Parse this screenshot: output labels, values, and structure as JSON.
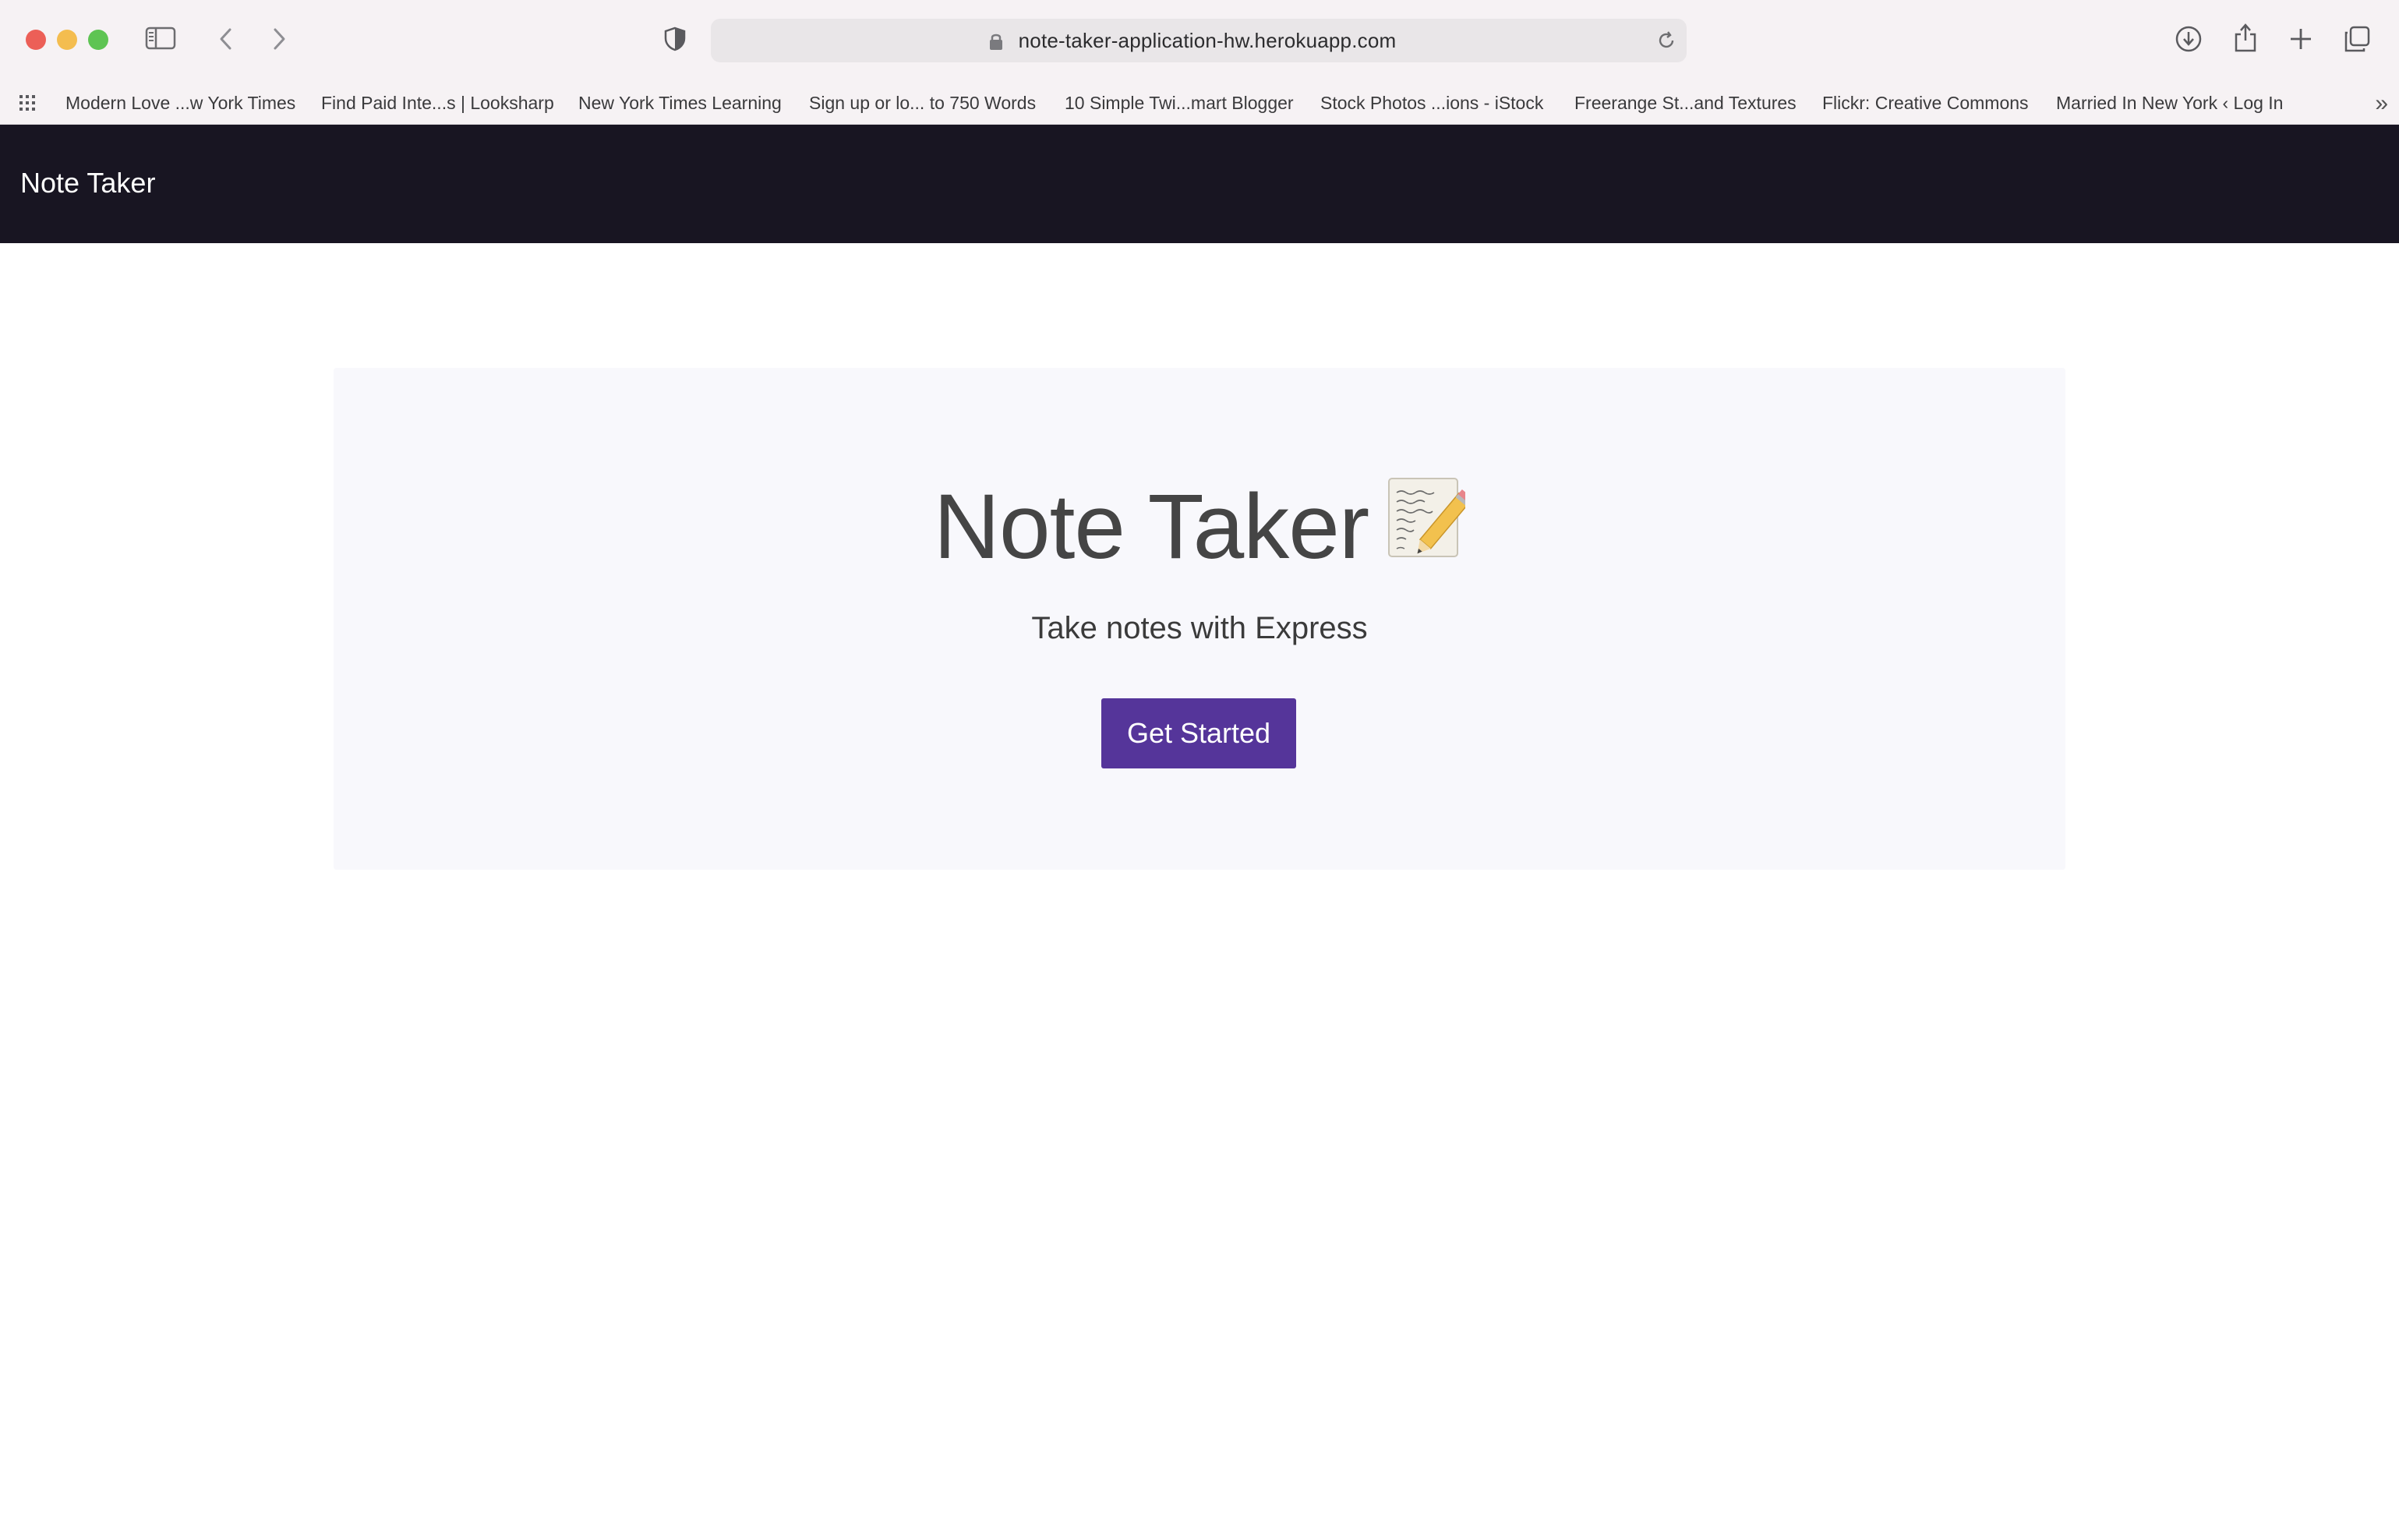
{
  "browser": {
    "url": "note-taker-application-hw.herokuapp.com",
    "bookmarks": [
      "Modern Love ...w York Times",
      "Find Paid Inte...s | Looksharp",
      "New York Times Learning",
      "Sign up or lo... to 750 Words",
      "10 Simple Twi...mart Blogger",
      "Stock Photos ...ions - iStock",
      "Freerange St...and Textures",
      "Flickr: Creative Commons",
      "Married In New York ‹ Log In"
    ],
    "overflow_label": "»"
  },
  "navbar": {
    "brand": "Note Taker"
  },
  "hero": {
    "title": "Note Taker",
    "emoji": "📝",
    "subtitle": "Take notes with Express",
    "button_label": "Get Started",
    "button_color": "#55359a"
  },
  "icons": [
    "sidebar-toggle-icon",
    "back-arrow-icon",
    "forward-arrow-icon",
    "privacy-shield-icon",
    "lock-icon",
    "reload-icon",
    "download-icon",
    "share-icon",
    "new-tab-icon",
    "tab-overview-icon",
    "bookmarks-grid-icon"
  ]
}
